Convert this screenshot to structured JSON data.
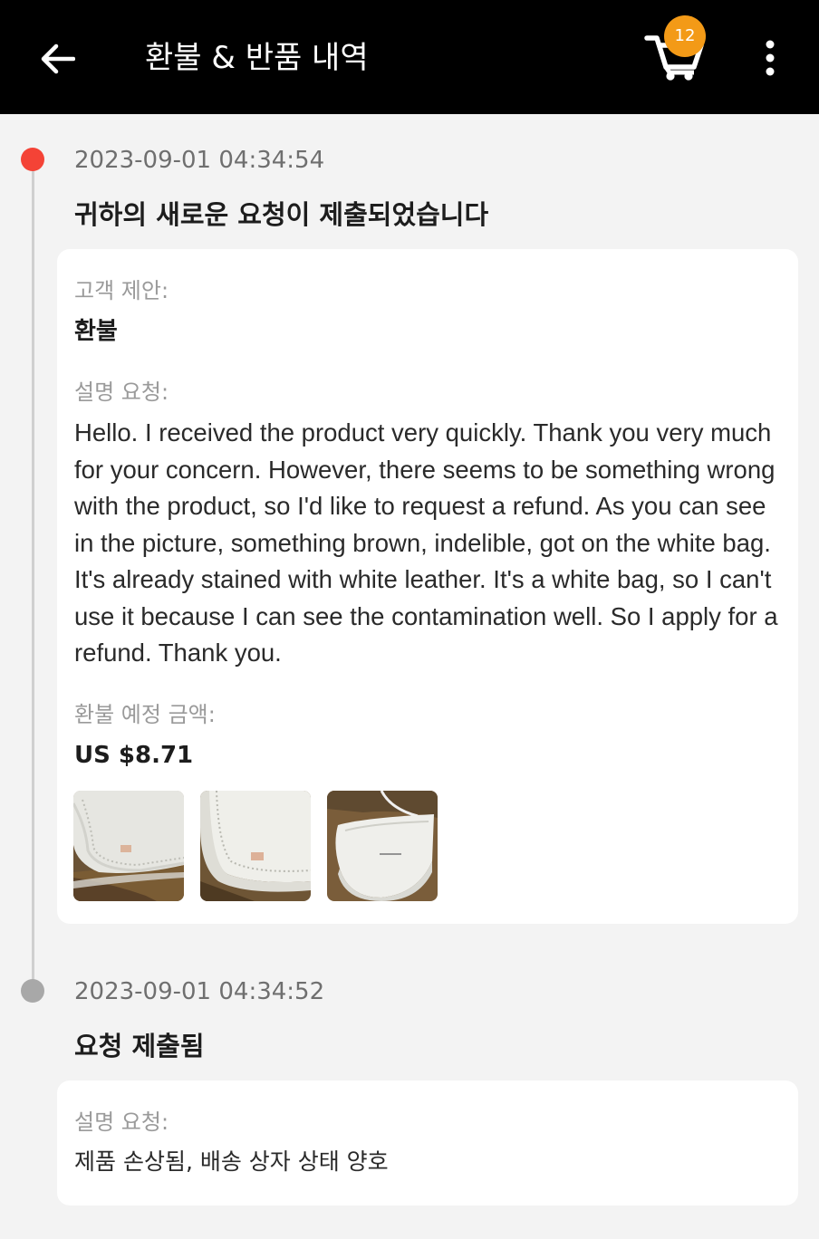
{
  "header": {
    "title": "환불 & 반품 내역",
    "cart_count": "12",
    "back_icon": "arrow-left-icon",
    "cart_icon": "shopping-cart-icon",
    "more_icon": "more-vertical-icon"
  },
  "colors": {
    "header_bg": "#000000",
    "badge": "#f39a17",
    "active_dot": "#f44336",
    "past_dot": "#a8a8a8",
    "page_bg": "#f3f3f3"
  },
  "timeline": [
    {
      "time": "2023-09-01 04:34:54",
      "title": "귀하의 새로운 요청이 제출되었습니다",
      "fields": {
        "proposal_label": "고객 제안:",
        "proposal_value": "환불",
        "desc_label": "설명 요청:",
        "desc_value": "Hello. I received the product very quickly. Thank you very much for your concern. However, there seems to be something wrong with the product, so I'd like to request a refund. As you can see in the picture, something brown, indelible, got on the white bag. It's already stained with white leather. It's a white bag, so I can't use it because I can see the contamination well. So I apply for a refund. Thank you.",
        "amount_label": "환불 예정 금액:",
        "amount_value": "US $8.71"
      },
      "photos": [
        "bag-stain-closeup-photo",
        "bag-edge-stain-photo",
        "white-bag-photo"
      ]
    },
    {
      "time": "2023-09-01 04:34:52",
      "title": "요청 제출됨",
      "fields": {
        "desc_label": "설명 요청:",
        "desc_value": "제품 손상됨, 배송 상자 상태 양호"
      }
    }
  ]
}
